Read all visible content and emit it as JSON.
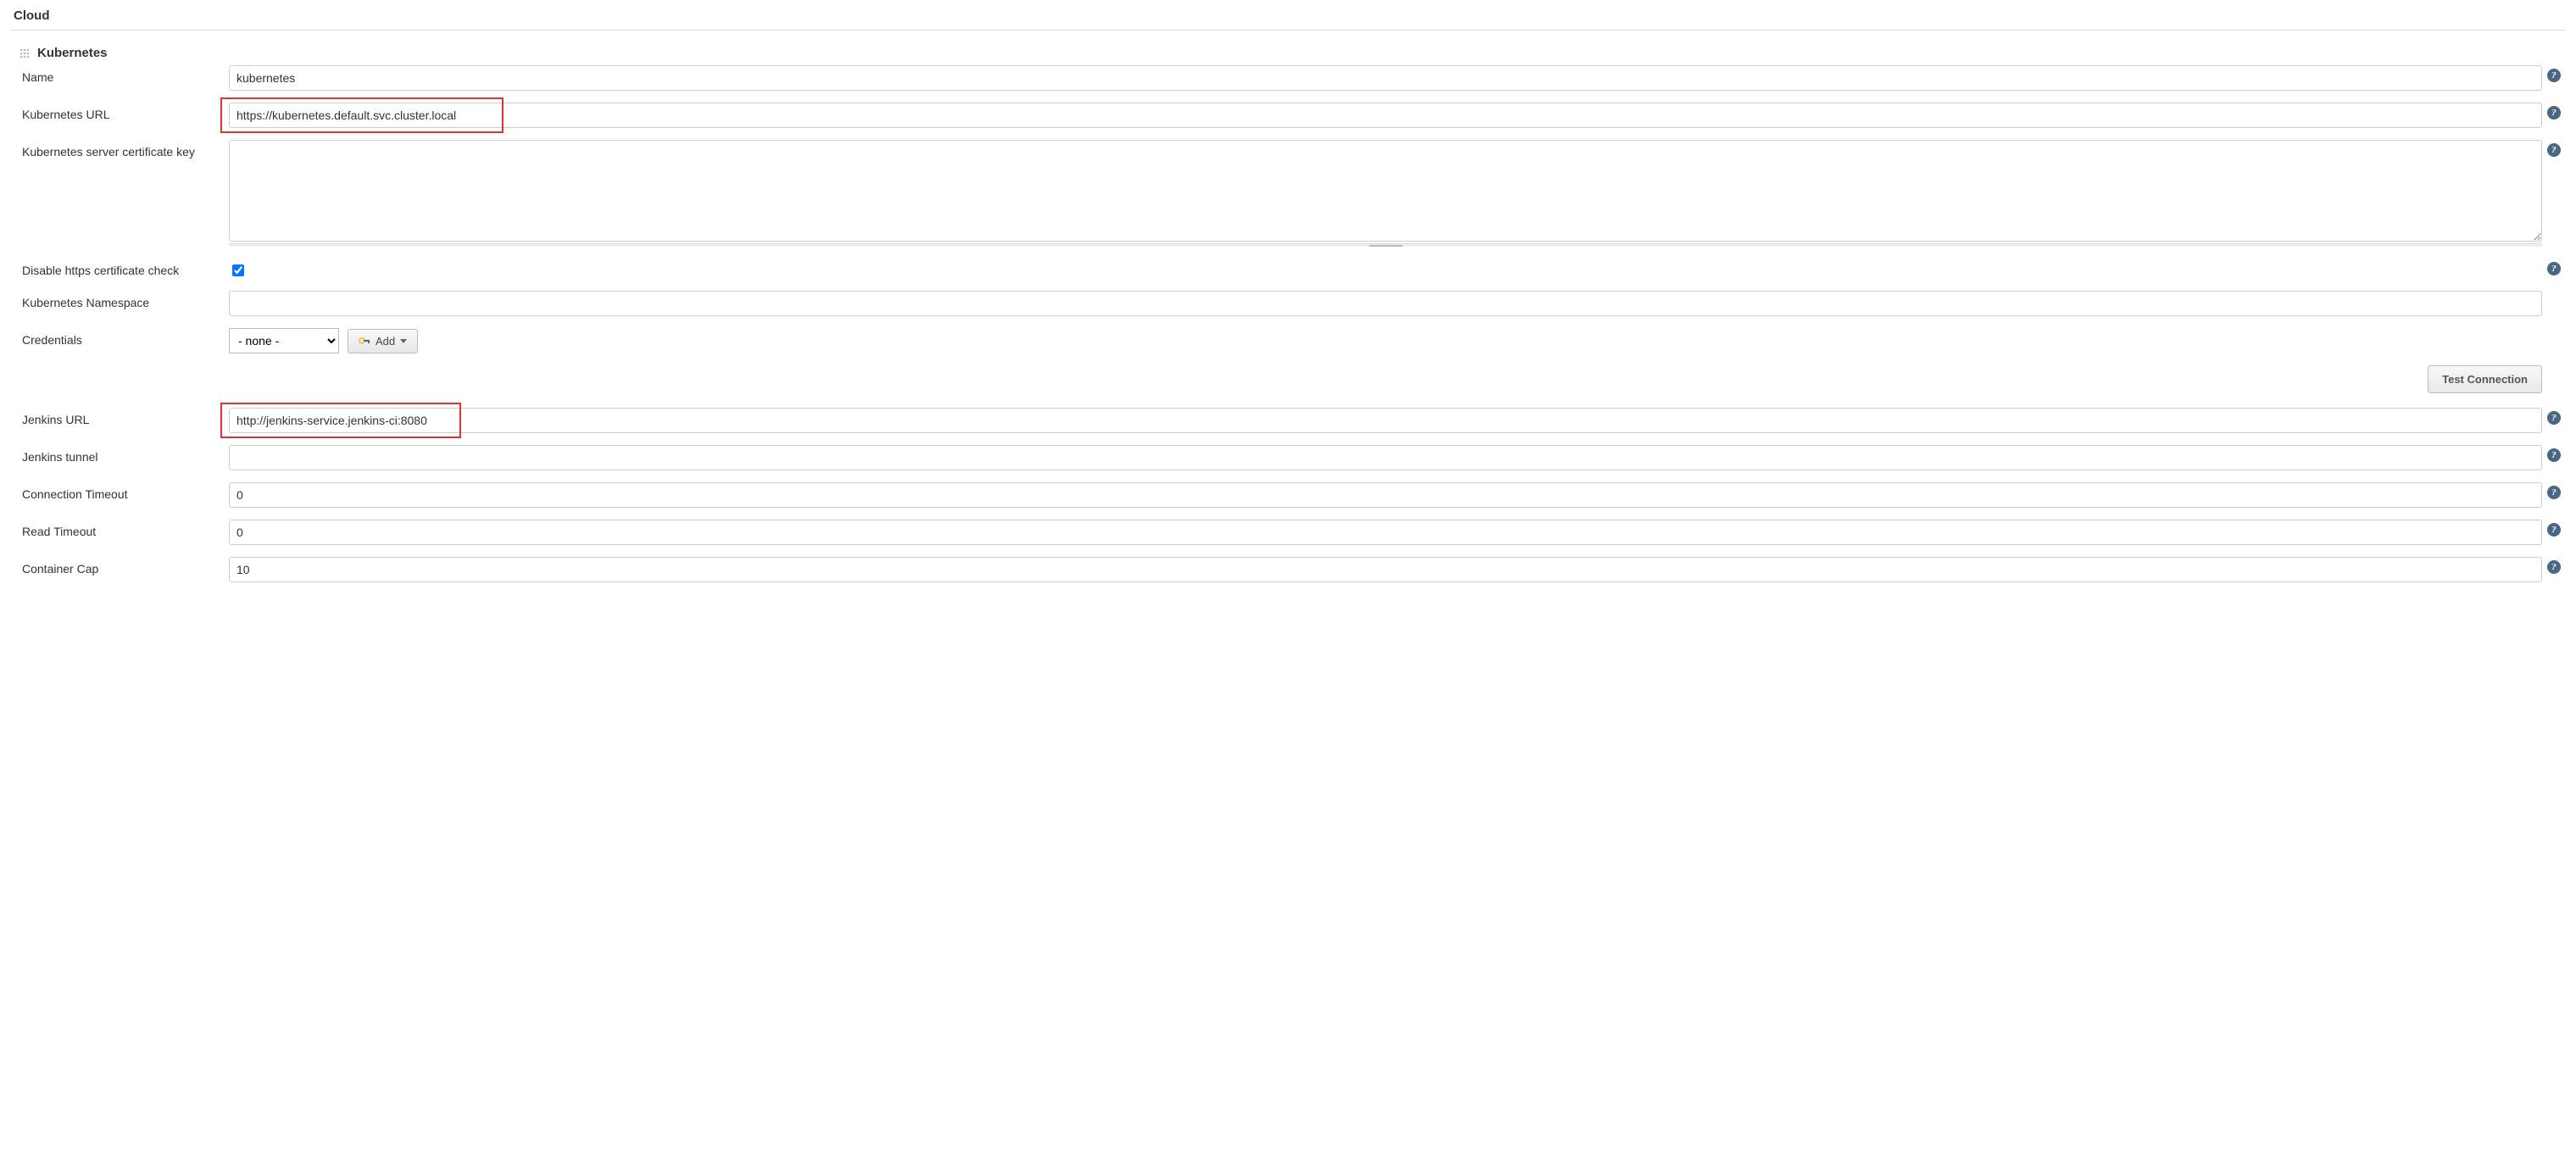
{
  "section_title": "Cloud",
  "cloud": {
    "header": "Kubernetes",
    "fields": {
      "name": {
        "label": "Name",
        "value": "kubernetes"
      },
      "k8s_url": {
        "label": "Kubernetes URL",
        "value": "https://kubernetes.default.svc.cluster.local"
      },
      "cert_key": {
        "label": "Kubernetes server certificate key",
        "value": ""
      },
      "disable_https": {
        "label": "Disable https certificate check",
        "checked": true
      },
      "namespace": {
        "label": "Kubernetes Namespace",
        "value": ""
      },
      "credentials": {
        "label": "Credentials",
        "selected": "- none -",
        "add_button": "Add"
      },
      "test_connection_button": "Test Connection",
      "jenkins_url": {
        "label": "Jenkins URL",
        "value": "http://jenkins-service.jenkins-ci:8080"
      },
      "jenkins_tunnel": {
        "label": "Jenkins tunnel",
        "value": ""
      },
      "conn_timeout": {
        "label": "Connection Timeout",
        "value": "0"
      },
      "read_timeout": {
        "label": "Read Timeout",
        "value": "0"
      },
      "container_cap": {
        "label": "Container Cap",
        "value": "10"
      }
    }
  }
}
